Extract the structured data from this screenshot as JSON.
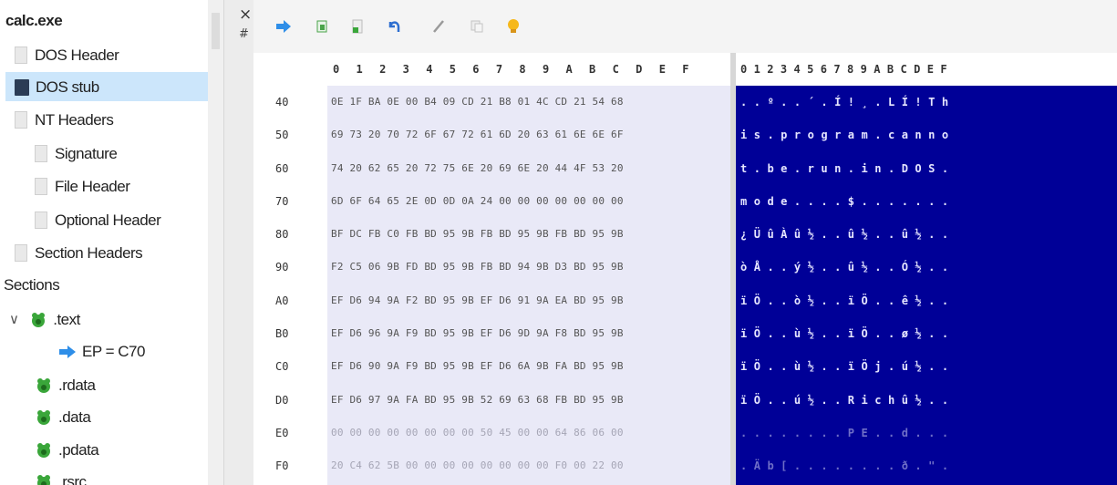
{
  "tree": {
    "file_name": "calc.exe",
    "items": [
      {
        "label": "DOS Header",
        "icon": "document-icon"
      },
      {
        "label": "DOS stub",
        "icon": "dos-stub-icon"
      },
      {
        "label": "NT Headers",
        "icon": "document-icon"
      },
      {
        "label": "Signature",
        "icon": "document-icon"
      },
      {
        "label": "File Header",
        "icon": "document-icon"
      },
      {
        "label": "Optional Header",
        "icon": "document-icon"
      },
      {
        "label": "Section Headers",
        "icon": "document-icon"
      },
      {
        "label": "Sections"
      },
      {
        "label": ".text",
        "icon": "section-icon"
      },
      {
        "label": "EP = C70",
        "icon": "arrow-right-icon"
      },
      {
        "label": ".rdata",
        "icon": "section-icon"
      },
      {
        "label": ".data",
        "icon": "section-icon"
      },
      {
        "label": ".pdata",
        "icon": "section-icon"
      },
      {
        "label": ".rsrc",
        "icon": "section-icon"
      }
    ]
  },
  "strip": {
    "close_glyph": "×",
    "pin_glyph": "#"
  },
  "toolbar": {
    "buttons": [
      "forward-arrow-icon",
      "refresh-green-icon",
      "page-green-icon",
      "undo-icon",
      "pencil-icon",
      "copy-icon",
      "bulb-icon"
    ]
  },
  "hex": {
    "hex_header": "0 1 2 3 4 5 6 7 8 9 A B C D E F",
    "ascii_header": "0123456789ABCDEF",
    "offsets": [
      "40",
      "50",
      "60",
      "70",
      "80",
      "90",
      "A0",
      "B0",
      "C0",
      "D0",
      "E0",
      "F0"
    ],
    "hex_rows": [
      "0E 1F BA 0E 00 B4 09 CD 21 B8 01 4C CD 21 54 68",
      "69 73 20 70 72 6F 67 72 61 6D 20 63 61 6E 6E 6F",
      "74 20 62 65 20 72 75 6E 20 69 6E 20 44 4F 53 20",
      "6D 6F 64 65 2E 0D 0D 0A 24 00 00 00 00 00 00 00",
      "BF DC FB C0 FB BD 95 9B FB BD 95 9B FB BD 95 9B",
      "F2 C5 06 9B FD BD 95 9B FB BD 94 9B D3 BD 95 9B",
      "EF D6 94 9A F2 BD 95 9B EF D6 91 9A EA BD 95 9B",
      "EF D6 96 9A F9 BD 95 9B EF D6 9D 9A F8 BD 95 9B",
      "EF D6 90 9A F9 BD 95 9B EF D6 6A 9B FA BD 95 9B",
      "EF D6 97 9A FA BD 95 9B 52 69 63 68 FB BD 95 9B",
      "00 00 00 00 00 00 00 00 50 45 00 00 64 86 06 00",
      "20 C4 62 5B 00 00 00 00 00 00 00 00 F0 00 22 00"
    ],
    "ascii_rows": [
      "..º..´.Í!¸.LÍ!Th",
      "is.program.canno",
      "t.be.run.in.DOS.",
      "mode....$.......",
      "¿ÜûÀû½..û½..û½..",
      "òÅ..ý½..û½..Ó½..",
      "ïÖ..ò½..ïÖ..ê½..",
      "ïÖ..ù½..ïÖ..ø½..",
      "ïÖ..ù½..ïÖj.ú½..",
      "ïÖ..ú½..Richû½..",
      "........PE..d...",
      ".Äb[........ð.\"."
    ]
  }
}
